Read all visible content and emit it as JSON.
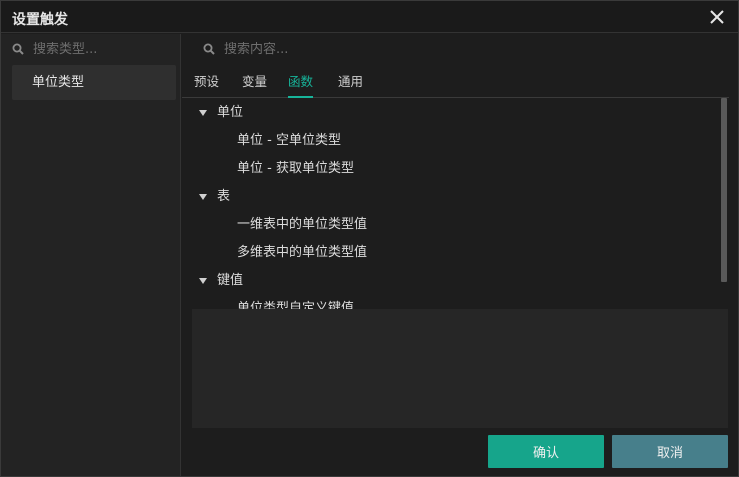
{
  "window": {
    "title": "设置触发"
  },
  "left": {
    "search_placeholder": "搜索类型...",
    "categories": [
      {
        "label": "单位类型"
      }
    ]
  },
  "right": {
    "search_placeholder": "搜索内容...",
    "tabs": [
      {
        "label": "预设"
      },
      {
        "label": "变量"
      },
      {
        "label": "函数",
        "active": true
      },
      {
        "label": "通用"
      }
    ],
    "tree": [
      {
        "label": "单位",
        "children": [
          "单位 - 空单位类型",
          "单位 - 获取单位类型"
        ]
      },
      {
        "label": "表",
        "children": [
          "一维表中的单位类型值",
          "多维表中的单位类型值"
        ]
      },
      {
        "label": "键值",
        "children": [
          "单位类型自定义键值"
        ]
      }
    ]
  },
  "buttons": {
    "ok": "确认",
    "cancel": "取消"
  },
  "colors": {
    "accent": "#17b49a",
    "ok_button": "#16a58b",
    "cancel_button": "#477f8b"
  }
}
